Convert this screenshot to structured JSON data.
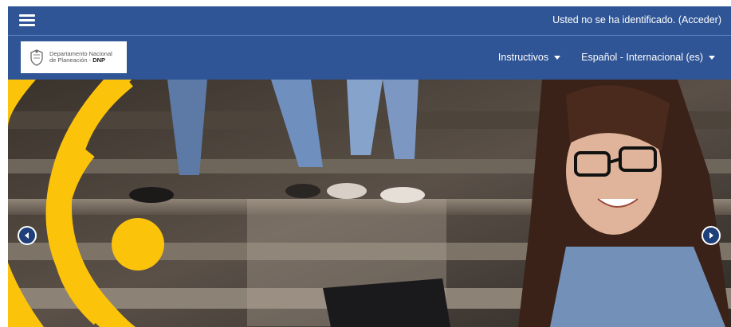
{
  "topbar": {
    "menu_icon": "hamburger-icon",
    "login_text": "Usted no se ha identificado. (Acceder)"
  },
  "navbar": {
    "logo": {
      "line1": "Departamento Nacional",
      "line2": "de Planeación - ",
      "line2_bold": "DNP"
    },
    "menu": [
      {
        "label": "Instructivos",
        "icon": "caret-down-icon"
      },
      {
        "label": "Español - Internacional (es)",
        "icon": "caret-down-icon"
      }
    ]
  },
  "carousel": {
    "prev_icon": "chevron-left-icon",
    "next_icon": "chevron-right-icon"
  },
  "colors": {
    "header_blue": "#2f5596",
    "accent_yellow": "#fcc30b",
    "white": "#ffffff"
  }
}
